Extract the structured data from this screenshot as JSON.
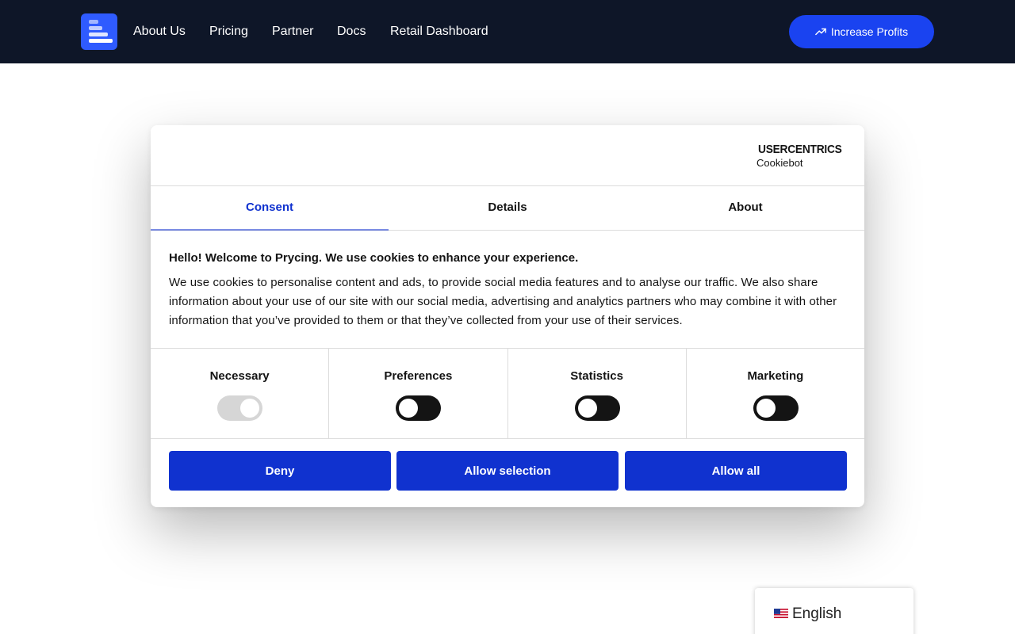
{
  "header": {
    "nav": [
      "About Us",
      "Pricing",
      "Partner",
      "Docs",
      "Retail Dashboard"
    ],
    "cta_label": "Increase Profits",
    "cta_icon": "trending-up-icon"
  },
  "consent": {
    "brand_name": "USERCENTRICS",
    "brand_sub": "Cookiebot",
    "tabs": [
      "Consent",
      "Details",
      "About"
    ],
    "active_tab": "Consent",
    "title": "Hello! Welcome to Prycing. We use cookies to enhance your experience.",
    "body": "We use cookies to personalise content and ads, to provide social media features and to analyse our traffic. We also share information about your use of our site with our social media, advertising and analytics partners who may combine it with other information that you’ve provided to them or that they’ve collected from your use of their services.",
    "categories": [
      {
        "label": "Necessary",
        "checked": true,
        "disabled": true
      },
      {
        "label": "Preferences",
        "checked": false,
        "disabled": false
      },
      {
        "label": "Statistics",
        "checked": false,
        "disabled": false
      },
      {
        "label": "Marketing",
        "checked": false,
        "disabled": false
      }
    ],
    "buttons": {
      "deny": "Deny",
      "allow_selection": "Allow selection",
      "allow_all": "Allow all"
    },
    "accent_color": "#1032cf"
  },
  "language": {
    "label": "English",
    "flag": "us-flag-icon"
  }
}
